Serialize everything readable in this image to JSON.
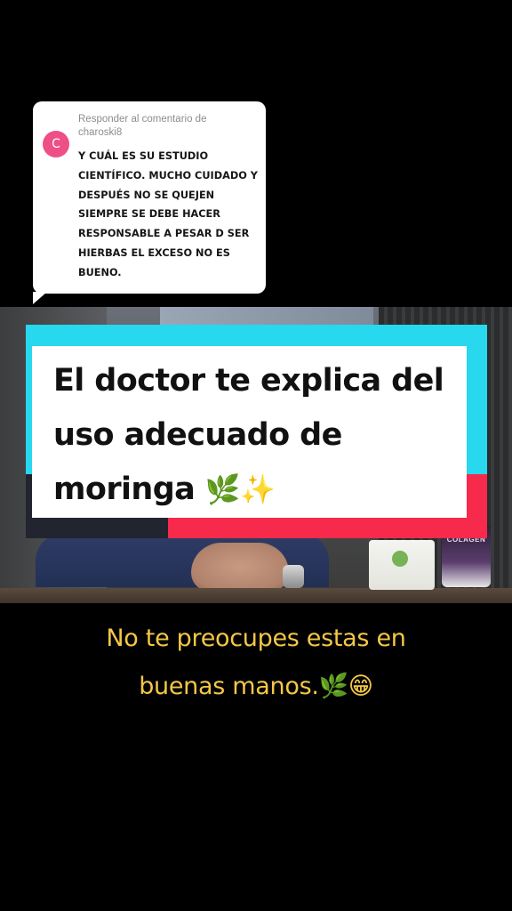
{
  "reply": {
    "avatar_letter": "C",
    "header_prefix": "Responder al comentario de",
    "username": "charoski8",
    "comment_text": "Y CUÁL ES SU ESTUDIO CIENTÍFICO. MUCHO CUIDADO Y DESPUÉS NO SE QUEJEN SIEMPRE SE DEBE HACER RESPONSABLE A PESAR D SER HIERBAS EL EXCESO NO ES BUENO."
  },
  "video": {
    "bottle_label": "COLAGEN"
  },
  "banner": {
    "line1": "El doctor te explica del",
    "line2": "uso adecuado de",
    "line3": "moringa",
    "emoji": "🌿✨",
    "colors": {
      "cyan": "#27d8ee",
      "red": "#f72a4b",
      "white": "#ffffff"
    }
  },
  "caption": {
    "line1": "No te preocupes estas en",
    "line2": "buenas manos.🌿😁",
    "color": "#f3c747"
  }
}
